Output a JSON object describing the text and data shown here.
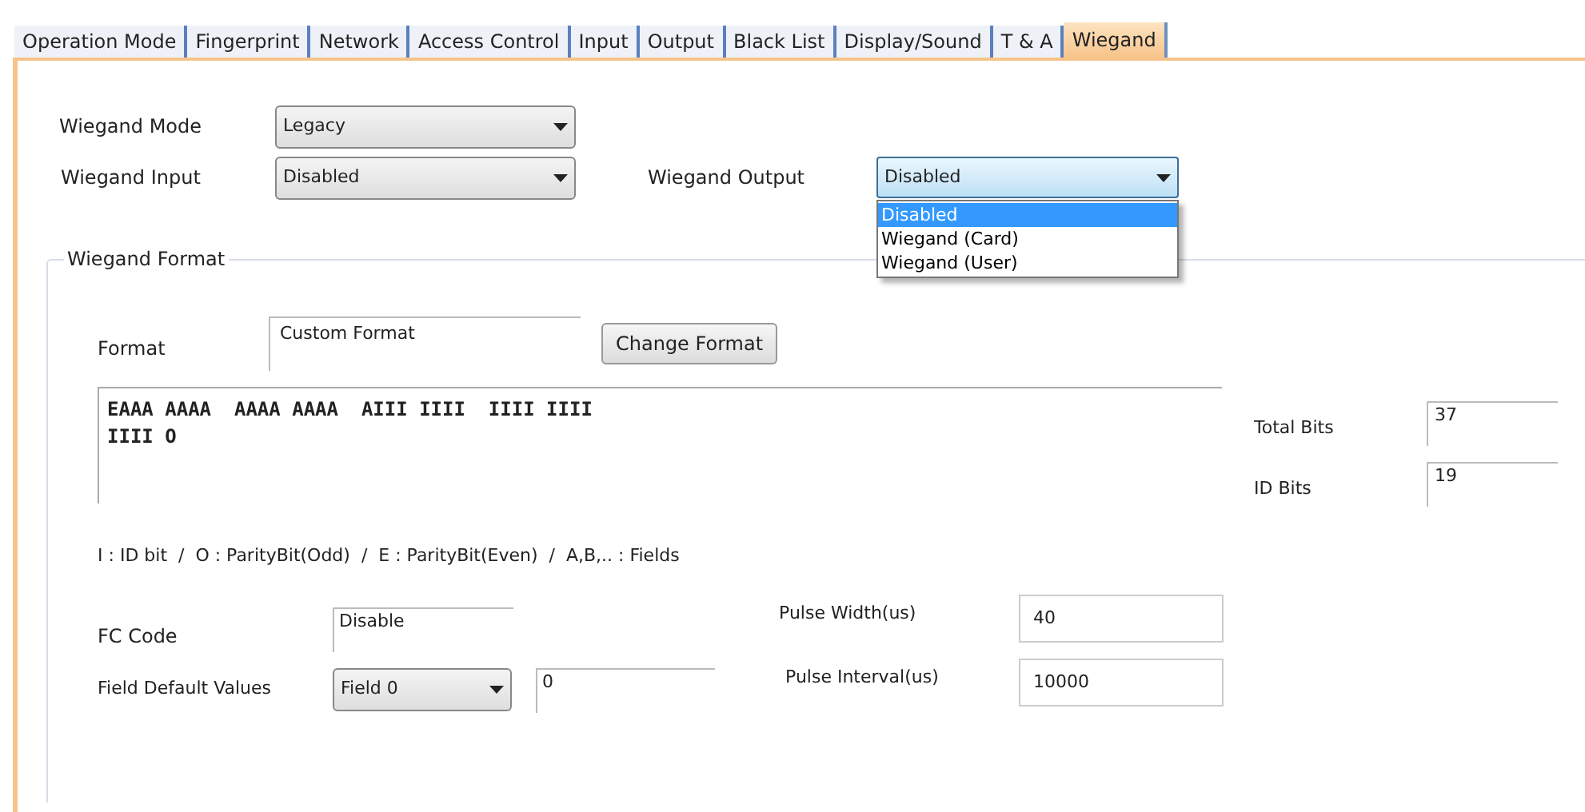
{
  "tabs": [
    {
      "label": "Operation Mode",
      "selected": false
    },
    {
      "label": "Fingerprint",
      "selected": false
    },
    {
      "label": "Network",
      "selected": false
    },
    {
      "label": "Access Control",
      "selected": false
    },
    {
      "label": "Input",
      "selected": false
    },
    {
      "label": "Output",
      "selected": false
    },
    {
      "label": "Black List",
      "selected": false
    },
    {
      "label": "Display/Sound",
      "selected": false
    },
    {
      "label": "T & A",
      "selected": false
    },
    {
      "label": "Wiegand",
      "selected": true
    }
  ],
  "wiegand_mode": {
    "label": "Wiegand Mode",
    "value": "Legacy"
  },
  "wiegand_input": {
    "label": "Wiegand Input",
    "value": "Disabled"
  },
  "wiegand_output": {
    "label": "Wiegand Output",
    "value": "Disabled",
    "expanded": true,
    "options": [
      {
        "label": "Disabled",
        "selected": true
      },
      {
        "label": "Wiegand (Card)",
        "selected": false
      },
      {
        "label": "Wiegand (User)",
        "selected": false
      }
    ]
  },
  "wiegand_format": {
    "title": "Wiegand Format",
    "format": {
      "label": "Format",
      "value": "Custom Format"
    },
    "change_button": "Change Format",
    "bit_pattern": [
      "EAAA AAAA  AAAA AAAA  AIII IIII  IIII IIII",
      "IIII O"
    ],
    "total_bits": {
      "label": "Total Bits",
      "value": "37"
    },
    "id_bits": {
      "label": "ID Bits",
      "value": "19"
    },
    "legend": "I : ID bit  /  O : ParityBit(Odd)  /  E : ParityBit(Even)  /  A,B,.. : Fields",
    "fc_code": {
      "label": "FC Code",
      "value": "Disable"
    },
    "field_default": {
      "label": "Field Default Values",
      "select": "Field 0",
      "value": "0"
    },
    "pulse_width": {
      "label": "Pulse Width(us)",
      "value": "40"
    },
    "pulse_interval": {
      "label": "Pulse Interval(us)",
      "value": "10000"
    }
  }
}
